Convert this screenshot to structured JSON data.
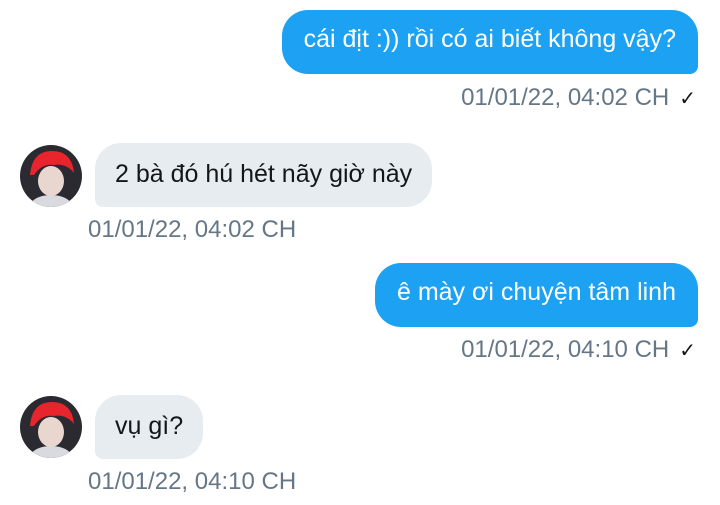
{
  "messages": [
    {
      "direction": "out",
      "text": "cái địt :)) rồi có ai biết không vậy?",
      "timestamp": "01/01/22, 04:02 CH",
      "status_icon": "checkmark-icon"
    },
    {
      "direction": "in",
      "text": "2 bà đó hú hét nãy giờ này",
      "timestamp": "01/01/22, 04:02 CH"
    },
    {
      "direction": "out",
      "text": "ê mày ơi chuyện tâm linh",
      "timestamp": "01/01/22, 04:10 CH",
      "status_icon": "checkmark-icon"
    },
    {
      "direction": "in",
      "text": "vụ gì?",
      "timestamp": "01/01/22, 04:10 CH"
    }
  ],
  "status_glyph": "✓",
  "colors": {
    "outgoing_bubble": "#1da1f2",
    "incoming_bubble": "#e6ecf0",
    "timestamp": "#657786",
    "avatar_hair": "#e8242c"
  }
}
